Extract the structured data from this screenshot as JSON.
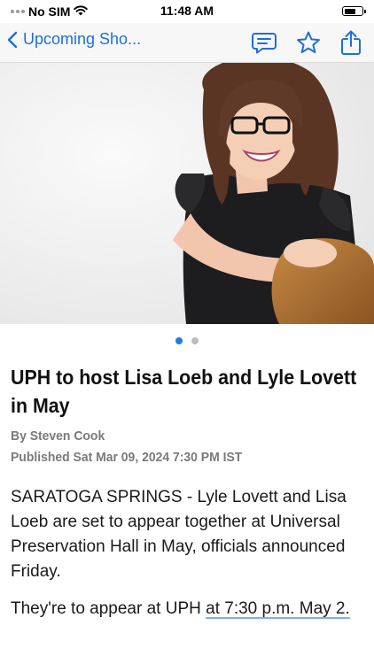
{
  "status_bar": {
    "carrier": "No SIM",
    "time": "11:48 AM",
    "battery_percent": 70
  },
  "nav": {
    "back_label": "Upcoming Sho...",
    "icons": [
      "comments-icon",
      "star-icon",
      "share-icon"
    ]
  },
  "colors": {
    "accent": "#1e6fd9",
    "page_dot_active": "#1e7ce6",
    "page_dot_inactive": "#bcbcbc"
  },
  "gallery": {
    "image": "photo-woman-with-glasses-and-guitar",
    "current_page": 1,
    "total_pages": 2
  },
  "article": {
    "headline": "UPH to host Lisa Loeb and Lyle Lovett in May",
    "byline": "By Steven Cook",
    "published": "Published Sat Mar 09, 2024 7:30 PM IST",
    "paragraph1": "SARATOGA SPRINGS - Lyle Lovett and Lisa Loeb are set to appear together at Universal Preservation Hall in May, officials announced Friday.",
    "paragraph2_text": "They're to appear at UPH ",
    "paragraph2_link": "at 7:30 p.m. May 2."
  }
}
